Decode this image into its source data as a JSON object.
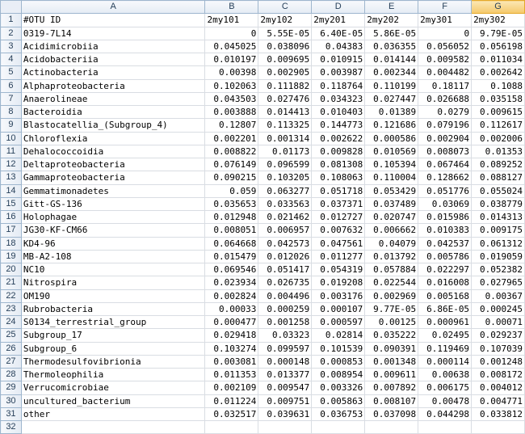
{
  "columns": [
    "A",
    "B",
    "C",
    "D",
    "E",
    "F",
    "G"
  ],
  "selected_column": "G",
  "rows": [
    [
      "#OTU ID",
      "2my101",
      "2my102",
      "2my201",
      "2my202",
      "2my301",
      "2my302"
    ],
    [
      "0319-7L14",
      "0",
      "5.55E-05",
      "6.40E-05",
      "5.86E-05",
      "0",
      "9.79E-05"
    ],
    [
      "Acidimicrobiia",
      "0.045025",
      "0.038096",
      "0.04383",
      "0.036355",
      "0.056052",
      "0.056198"
    ],
    [
      "Acidobacteriia",
      "0.010197",
      "0.009695",
      "0.010915",
      "0.014144",
      "0.009582",
      "0.011034"
    ],
    [
      "Actinobacteria",
      "0.00398",
      "0.002905",
      "0.003987",
      "0.002344",
      "0.004482",
      "0.002642"
    ],
    [
      "Alphaproteobacteria",
      "0.102063",
      "0.111882",
      "0.118764",
      "0.110199",
      "0.18117",
      "0.1088"
    ],
    [
      "Anaerolineae",
      "0.043503",
      "0.027476",
      "0.034323",
      "0.027447",
      "0.026688",
      "0.035158"
    ],
    [
      "Bacteroidia",
      "0.003888",
      "0.014413",
      "0.010403",
      "0.01389",
      "0.0279",
      "0.009615"
    ],
    [
      "Blastocatellia_(Subgroup_4)",
      "0.12807",
      "0.113325",
      "0.144773",
      "0.121686",
      "0.079196",
      "0.112617"
    ],
    [
      "Chloroflexia",
      "0.002201",
      "0.001314",
      "0.002622",
      "0.000586",
      "0.002904",
      "0.002006"
    ],
    [
      "Dehalococcoidia",
      "0.008822",
      "0.01173",
      "0.009828",
      "0.010569",
      "0.008073",
      "0.01353"
    ],
    [
      "Deltaproteobacteria",
      "0.076149",
      "0.096599",
      "0.081308",
      "0.105394",
      "0.067464",
      "0.089252"
    ],
    [
      "Gammaproteobacteria",
      "0.090215",
      "0.103205",
      "0.108063",
      "0.110004",
      "0.128662",
      "0.088127"
    ],
    [
      "Gemmatimonadetes",
      "0.059",
      "0.063277",
      "0.051718",
      "0.053429",
      "0.051776",
      "0.055024"
    ],
    [
      "Gitt-GS-136",
      "0.035653",
      "0.033563",
      "0.037371",
      "0.037489",
      "0.03069",
      "0.038779"
    ],
    [
      "Holophagae",
      "0.012948",
      "0.021462",
      "0.012727",
      "0.020747",
      "0.015986",
      "0.014313"
    ],
    [
      "JG30-KF-CM66",
      "0.008051",
      "0.006957",
      "0.007632",
      "0.006662",
      "0.010383",
      "0.009175"
    ],
    [
      "KD4-96",
      "0.064668",
      "0.042573",
      "0.047561",
      "0.04079",
      "0.042537",
      "0.061312"
    ],
    [
      "MB-A2-108",
      "0.015479",
      "0.012026",
      "0.011277",
      "0.013792",
      "0.005786",
      "0.019059"
    ],
    [
      "NC10",
      "0.069546",
      "0.051417",
      "0.054319",
      "0.057884",
      "0.022297",
      "0.052382"
    ],
    [
      "Nitrospira",
      "0.023934",
      "0.026735",
      "0.019208",
      "0.022544",
      "0.016008",
      "0.027965"
    ],
    [
      "OM190",
      "0.002824",
      "0.004496",
      "0.003176",
      "0.002969",
      "0.005168",
      "0.00367"
    ],
    [
      "Rubrobacteria",
      "0.00033",
      "0.000259",
      "0.000107",
      "9.77E-05",
      "6.86E-05",
      "0.000245"
    ],
    [
      "S0134_terrestrial_group",
      "0.000477",
      "0.001258",
      "0.000597",
      "0.00125",
      "0.000961",
      "0.00071"
    ],
    [
      "Subgroup_17",
      "0.029418",
      "0.03323",
      "0.02814",
      "0.035222",
      "0.02495",
      "0.029237"
    ],
    [
      "Subgroup_6",
      "0.103274",
      "0.099597",
      "0.101539",
      "0.090391",
      "0.119469",
      "0.107039"
    ],
    [
      "Thermodesulfovibrionia",
      "0.003081",
      "0.000148",
      "0.000853",
      "0.001348",
      "0.000114",
      "0.001248"
    ],
    [
      "Thermoleophilia",
      "0.011353",
      "0.013377",
      "0.008954",
      "0.009611",
      "0.00638",
      "0.008172"
    ],
    [
      "Verrucomicrobiae",
      "0.002109",
      "0.009547",
      "0.003326",
      "0.007892",
      "0.006175",
      "0.004012"
    ],
    [
      "uncultured_bacterium",
      "0.011224",
      "0.009751",
      "0.005863",
      "0.008107",
      "0.00478",
      "0.004771"
    ],
    [
      "other",
      "0.032517",
      "0.039631",
      "0.036753",
      "0.037098",
      "0.044298",
      "0.033812"
    ],
    [
      "",
      "",
      "",
      "",
      "",
      "",
      ""
    ]
  ]
}
